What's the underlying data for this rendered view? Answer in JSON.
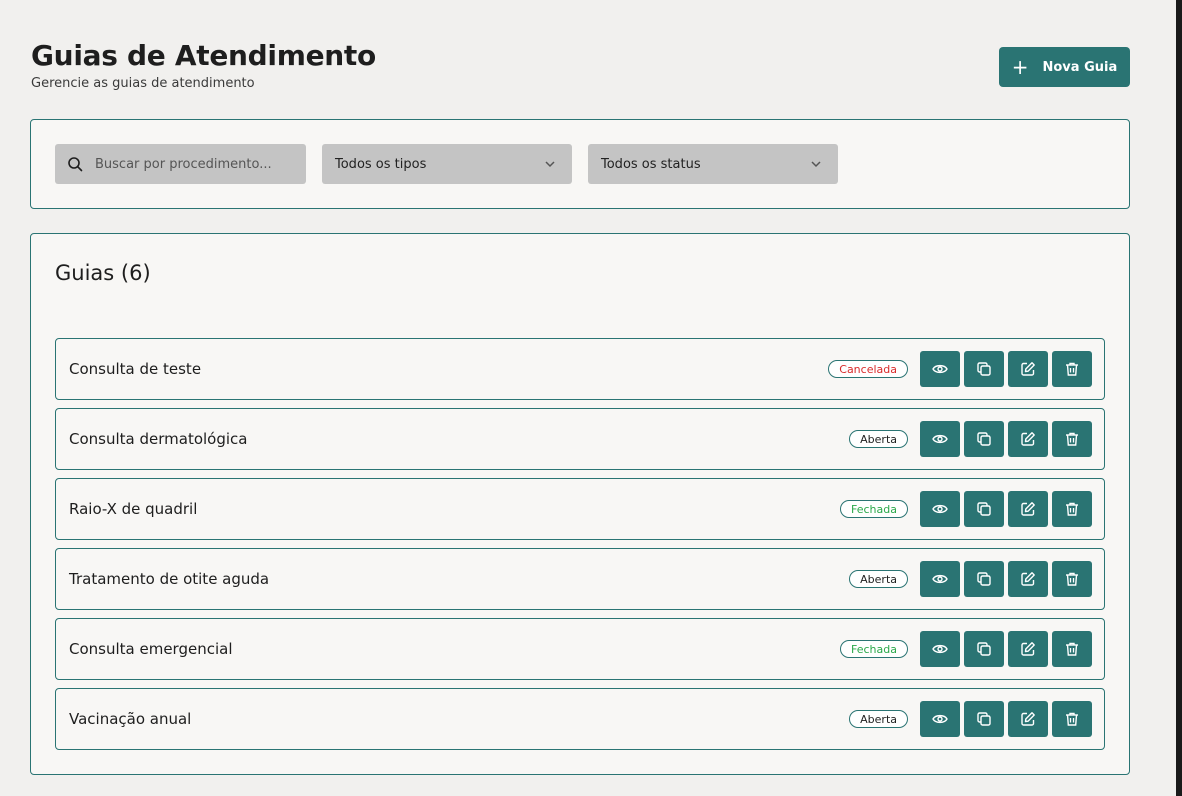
{
  "header": {
    "title": "Guias de Atendimento",
    "subtitle": "Gerencie as guias de atendimento",
    "new_button_label": "Nova Guia",
    "new_button_icon": "plus-icon"
  },
  "filters": {
    "search_placeholder": "Buscar por procedimento...",
    "search_icon": "search-icon",
    "type_select_value": "Todos os tipos",
    "status_select_value": "Todos os status"
  },
  "list": {
    "title": "Guias (6)",
    "actions": [
      "view-icon",
      "duplicate-icon",
      "edit-icon",
      "delete-icon"
    ],
    "rows": [
      {
        "name": "Consulta de teste",
        "status": "Cancelada",
        "status_color": "#d92b2b"
      },
      {
        "name": "Consulta dermatológica",
        "status": "Aberta",
        "status_color": "#1e1e1e"
      },
      {
        "name": "Raio-X de quadril",
        "status": "Fechada",
        "status_color": "#2aa84a"
      },
      {
        "name": "Tratamento de otite aguda",
        "status": "Aberta",
        "status_color": "#1e1e1e"
      },
      {
        "name": "Consulta emergencial",
        "status": "Fechada",
        "status_color": "#2aa84a"
      },
      {
        "name": "Vacinação anual",
        "status": "Aberta",
        "status_color": "#1e1e1e"
      }
    ]
  },
  "colors": {
    "accent": "#2a7473",
    "background": "#f1f0ee",
    "card": "#f8f7f5",
    "input": "#c4c4c4"
  }
}
